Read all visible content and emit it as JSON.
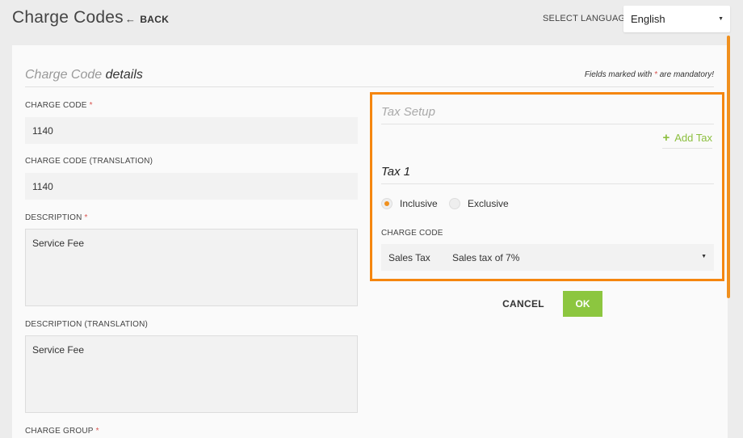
{
  "header": {
    "title": "Charge Codes",
    "back_label": "BACK",
    "language_label": "SELECT LANGUAGE",
    "language_value": "English"
  },
  "details": {
    "title_light": "Charge Code",
    "title_dark": "details",
    "mandatory_prefix": "Fields marked with",
    "mandatory_star": "*",
    "mandatory_suffix": "are mandatory!"
  },
  "fields": {
    "charge_code": {
      "label": "CHARGE CODE",
      "required": "*",
      "value": "1140"
    },
    "charge_code_translation": {
      "label": "CHARGE CODE (TRANSLATION)",
      "value": "1140"
    },
    "description": {
      "label": "DESCRIPTION",
      "required": "*",
      "value": "Service Fee"
    },
    "description_translation": {
      "label": "DESCRIPTION (TRANSLATION)",
      "value": "Service Fee"
    },
    "charge_group": {
      "label": "CHARGE GROUP",
      "required": "*"
    }
  },
  "tax": {
    "title": "Tax Setup",
    "add_label": "Add Tax",
    "tax1_title": "Tax 1",
    "inclusive_label": "Inclusive",
    "exclusive_label": "Exclusive",
    "selected_mode": "Inclusive",
    "charge_code_label": "CHARGE CODE",
    "charge_code_value": "Sales Tax",
    "charge_code_desc": "Sales tax of 7%"
  },
  "actions": {
    "cancel_label": "CANCEL",
    "ok_label": "OK"
  },
  "colors": {
    "accent_orange": "#f5860f",
    "ok_green": "#8cc63f",
    "add_tax_green": "#8cbf3f",
    "required_red": "#d9534f"
  },
  "icons": {
    "back": "arrow-left-icon",
    "dropdown": "caret-down-icon",
    "add": "plus-icon"
  }
}
